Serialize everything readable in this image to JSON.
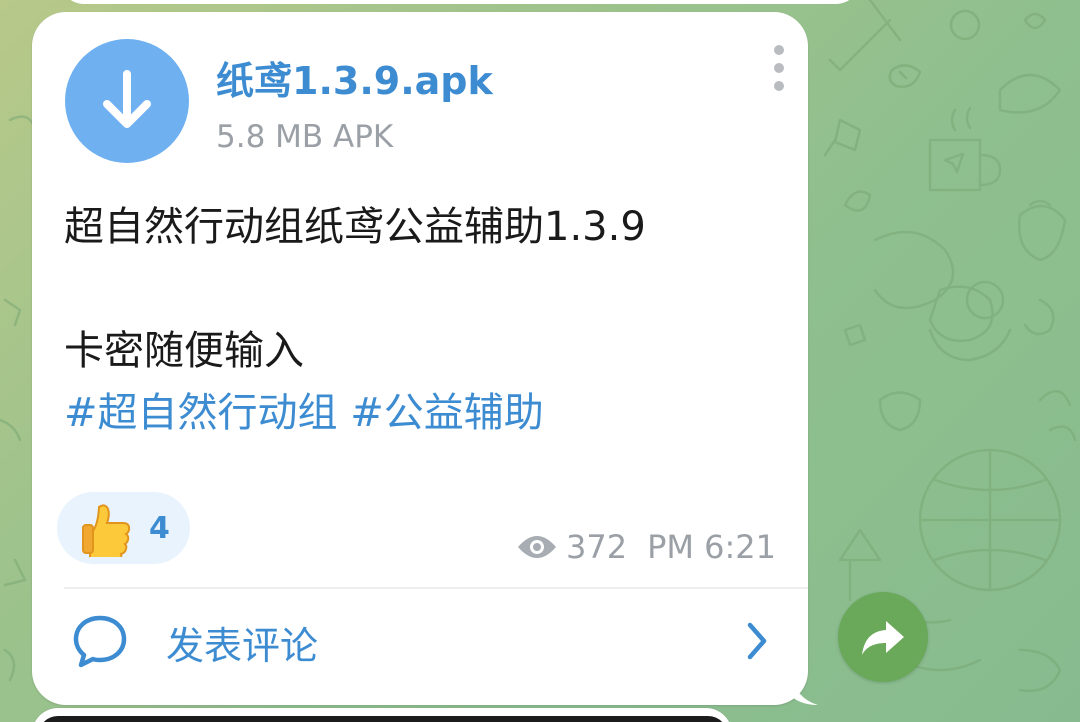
{
  "file": {
    "name": "纸鸢1.3.9.apk",
    "meta": "5.8 MB APK"
  },
  "message": {
    "line1": "超自然行动组纸鸢公益辅助1.3.9",
    "line2": "",
    "line3": "卡密随便输入",
    "hashtags": [
      "#超自然行动组",
      "#公益辅助"
    ]
  },
  "reaction": {
    "emoji": "thumbs-up-icon",
    "count": "4"
  },
  "stats": {
    "views": "372",
    "time": "PM 6:21"
  },
  "comments": {
    "label": "发表评论"
  },
  "colors": {
    "accent": "#3d8cd2",
    "file_icon": "#6fb0f0",
    "reaction_bg": "#e9f3fd",
    "meta": "#9aa0a6",
    "share_button": "#6aa85a",
    "bubble": "#ffffff"
  }
}
